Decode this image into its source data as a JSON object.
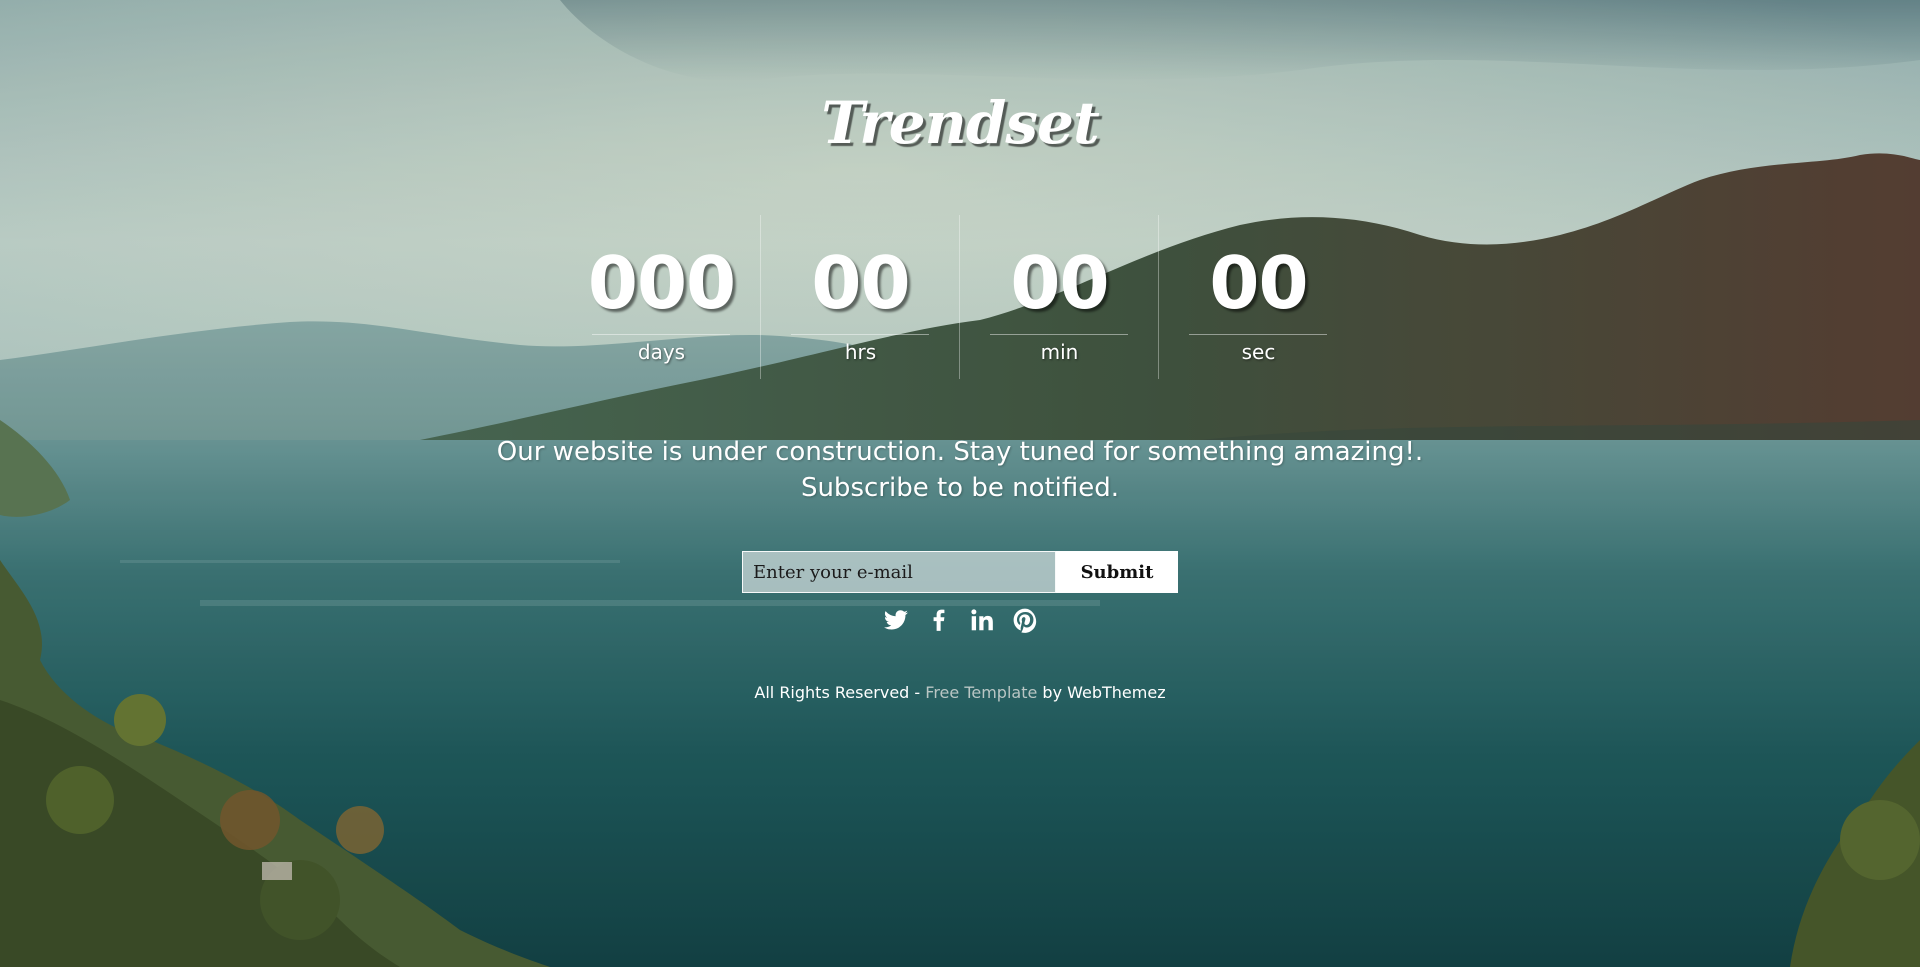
{
  "brand": {
    "logo_text": "Trendset"
  },
  "countdown": [
    {
      "value": "000",
      "label": "days"
    },
    {
      "value": "00",
      "label": "hrs"
    },
    {
      "value": "00",
      "label": "min"
    },
    {
      "value": "00",
      "label": "sec"
    }
  ],
  "message": {
    "line1": "Our website is under construction. Stay tuned for something amazing!.",
    "line2": "Subscribe to be notified."
  },
  "subscribe": {
    "email_placeholder": "Enter your e-mail",
    "submit_label": "Submit"
  },
  "social": [
    {
      "icon": "twitter-icon"
    },
    {
      "icon": "facebook-icon"
    },
    {
      "icon": "linkedin-icon"
    },
    {
      "icon": "pinterest-icon"
    }
  ],
  "footer": {
    "prefix": "All Rights Reserved - ",
    "link_text": "Free Template",
    "suffix": " by WebThemez"
  },
  "colors": {
    "text": "#ffffff",
    "footer_link": "#b9c6c4",
    "water": "#1f5a5c",
    "sky": "#b9d2cf"
  }
}
